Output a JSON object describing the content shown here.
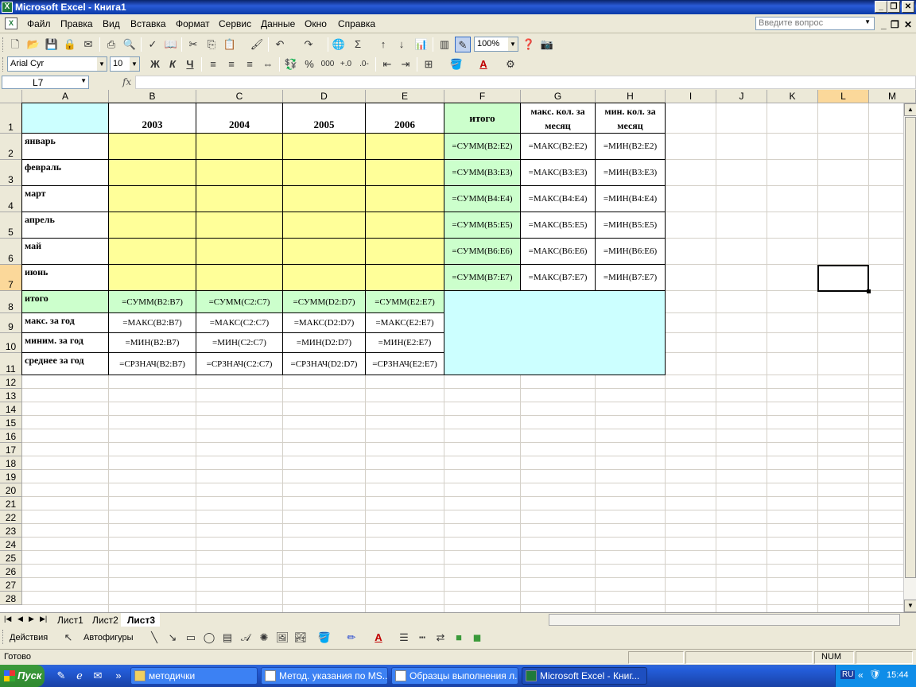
{
  "window": {
    "title": "Microsoft Excel - Книга1"
  },
  "menu": {
    "items": [
      "Файл",
      "Правка",
      "Вид",
      "Вставка",
      "Формат",
      "Сервис",
      "Данные",
      "Окно",
      "Справка"
    ],
    "help_placeholder": "Введите вопрос"
  },
  "toolbar": {
    "zoom": "100%",
    "font": "Arial Cyr",
    "size": "10",
    "bold": "Ж",
    "italic": "К",
    "underline": "Ч",
    "percent": "%",
    "thousands": "000",
    "sigma": "Σ",
    "fontcolor": "A"
  },
  "formula_bar": {
    "cell_ref": "L7",
    "fx": "fx",
    "content": ""
  },
  "sheet": {
    "columns": [
      "A",
      "B",
      "C",
      "D",
      "E",
      "F",
      "G",
      "H",
      "I",
      "J",
      "K",
      "L",
      "M"
    ],
    "rows": [
      "1",
      "2",
      "3",
      "4",
      "5",
      "6",
      "7",
      "8",
      "9",
      "10",
      "11",
      "12",
      "13",
      "14",
      "15",
      "16",
      "17",
      "18",
      "19",
      "20",
      "21",
      "22",
      "23",
      "24",
      "25",
      "26",
      "27",
      "28"
    ],
    "header_row": {
      "years": [
        "2003",
        "2004",
        "2005",
        "2006"
      ],
      "total": "итого",
      "max_month": "макс. кол. за месяц",
      "min_month": "мин. кол. за месяц"
    },
    "months": [
      {
        "name": "январь",
        "sum": "=СУММ(B2:E2)",
        "max": "=МАКС(B2:E2)",
        "min": "=МИН(B2:E2)"
      },
      {
        "name": "февраль",
        "sum": "=СУММ(B3:E3)",
        "max": "=МАКС(B3:E3)",
        "min": "=МИН(B3:E3)"
      },
      {
        "name": "март",
        "sum": "=СУММ(B4:E4)",
        "max": "=МАКС(B4:E4)",
        "min": "=МИН(B4:E4)"
      },
      {
        "name": "апрель",
        "sum": "=СУММ(B5:E5)",
        "max": "=МАКС(B5:E5)",
        "min": "=МИН(B5:E5)"
      },
      {
        "name": "май",
        "sum": "=СУММ(B6:E6)",
        "max": "=МАКС(B6:E6)",
        "min": "=МИН(B6:E6)"
      },
      {
        "name": "июнь",
        "sum": "=СУММ(B7:E7)",
        "max": "=МАКС(B7:E7)",
        "min": "=МИН(B7:E7)"
      }
    ],
    "summary": [
      {
        "label": "итого",
        "values": [
          "=СУММ(B2:B7)",
          "=СУММ(C2:C7)",
          "=СУММ(D2:D7)",
          "=СУММ(E2:E7)"
        ]
      },
      {
        "label": "макс. за год",
        "values": [
          "=МАКС(B2:B7)",
          "=МАКС(C2:C7)",
          "=МАКС(D2:D7)",
          "=МАКС(E2:E7)"
        ]
      },
      {
        "label": "миним. за год",
        "values": [
          "=МИН(B2:B7)",
          "=МИН(C2:C7)",
          "=МИН(D2:D7)",
          "=МИН(E2:E7)"
        ]
      },
      {
        "label": "среднее за год",
        "values": [
          "=СРЗНАЧ(B2:B7)",
          "=СРЗНАЧ(C2:C7)",
          "=СРЗНАЧ(D2:D7)",
          "=СРЗНАЧ(E2:E7)"
        ]
      }
    ],
    "colors": {
      "header_a": "#ccffff",
      "data_fill": "#ffff99",
      "total_col": "#ccffcc",
      "summary_fill": "#ccffff"
    }
  },
  "tabs": [
    "Лист1",
    "Лист2",
    "Лист3"
  ],
  "active_tab": "Лист3",
  "drawing": {
    "actions": "Действия",
    "autoshapes": "Автофигуры"
  },
  "status": {
    "ready": "Готово",
    "num": "NUM"
  },
  "taskbar": {
    "start": "Пуск",
    "tasks": [
      "методички",
      "Метод. указания по MS...",
      "Образцы выполнения л...",
      "Microsoft Excel - Книг..."
    ],
    "lang": "RU",
    "clock": "15:44"
  }
}
